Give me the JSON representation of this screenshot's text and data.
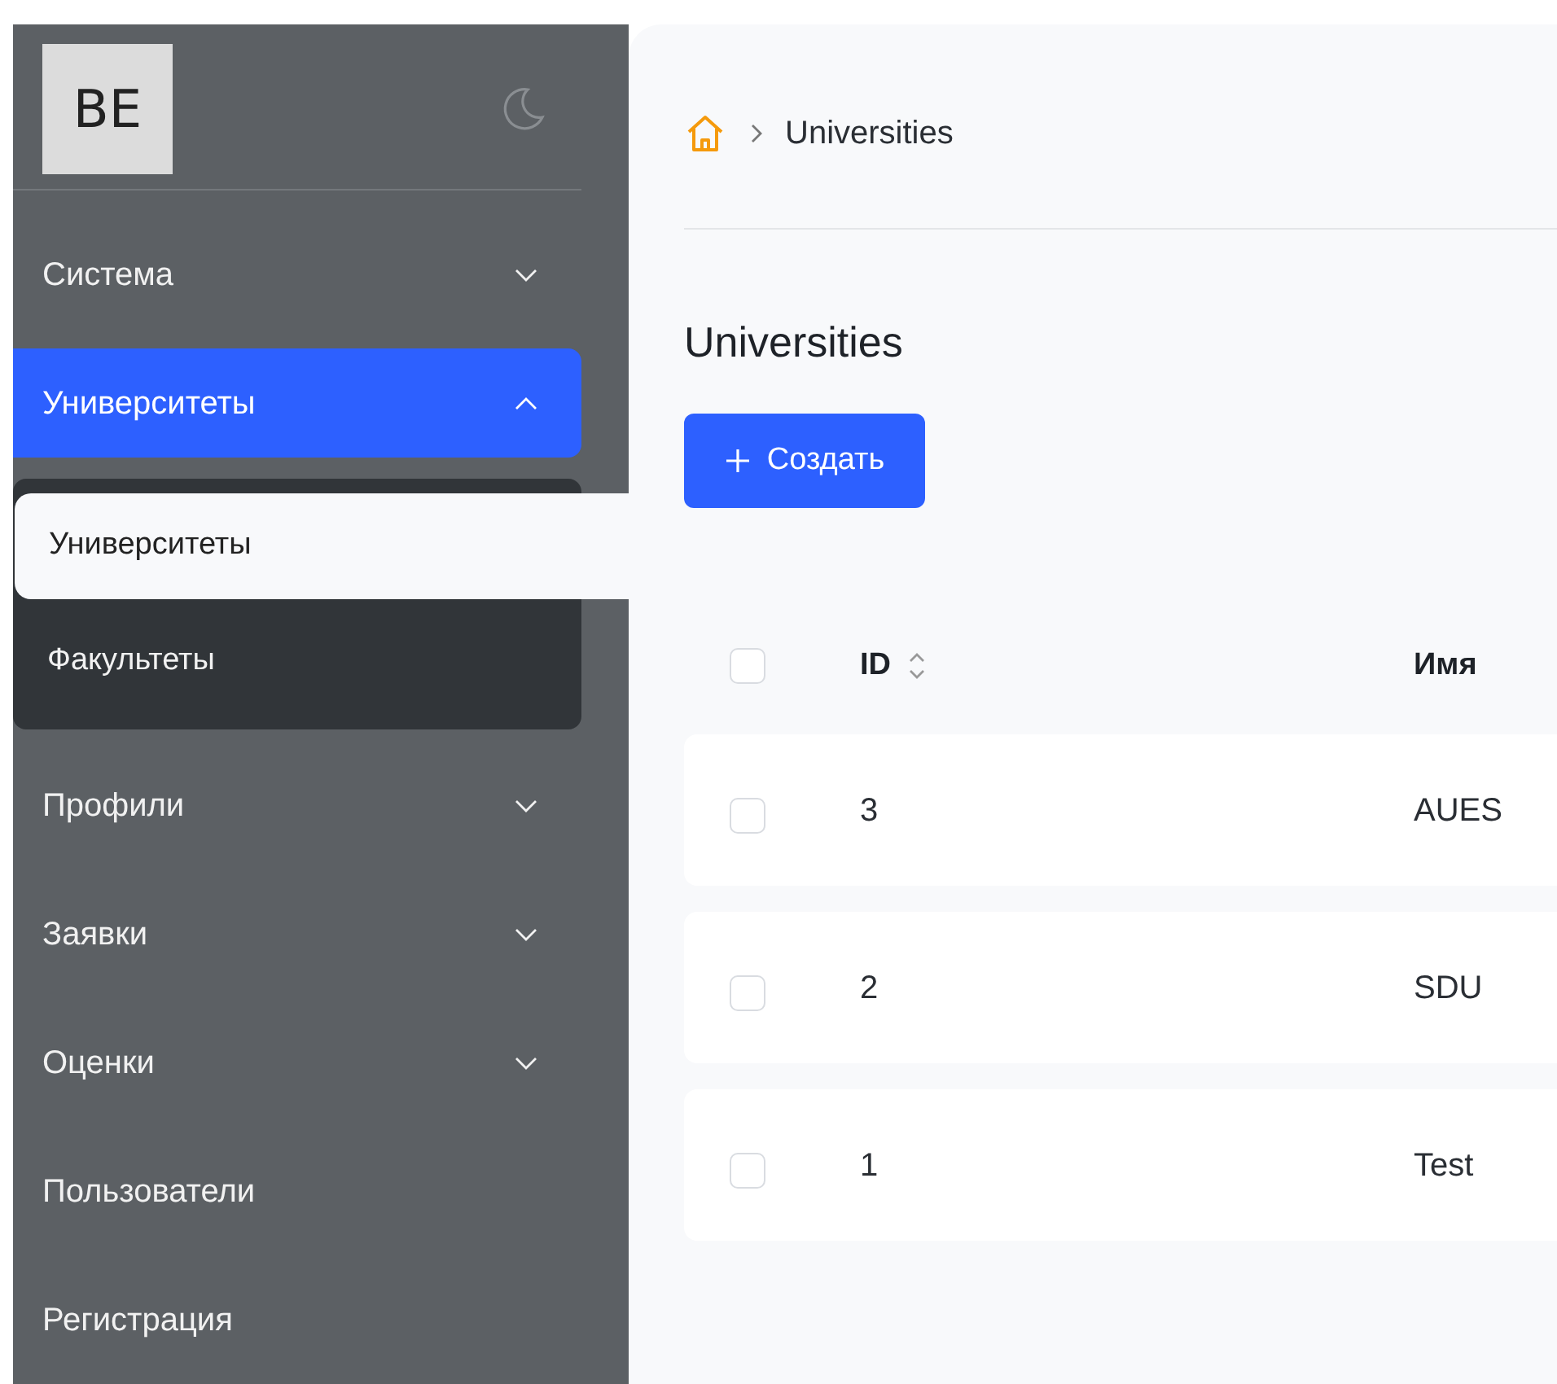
{
  "sidebar": {
    "logo": "BE",
    "items": [
      {
        "label": "Система",
        "kind": "group",
        "expanded": false,
        "selected": false
      },
      {
        "label": "Университеты",
        "kind": "group",
        "expanded": true,
        "selected": true,
        "children": [
          {
            "label": "Университеты",
            "selected": true
          },
          {
            "label": "Факультеты",
            "selected": false
          }
        ]
      },
      {
        "label": "Профили",
        "kind": "group",
        "expanded": false,
        "selected": false
      },
      {
        "label": "Заявки",
        "kind": "group",
        "expanded": false,
        "selected": false
      },
      {
        "label": "Оценки",
        "kind": "group",
        "expanded": false,
        "selected": false
      },
      {
        "label": "Пользователи",
        "kind": "link",
        "selected": false
      },
      {
        "label": "Регистрация",
        "kind": "link",
        "selected": false
      }
    ]
  },
  "breadcrumb": [
    "Universities"
  ],
  "title": "Universities",
  "create_button": "Создать",
  "table": {
    "select_all": {
      "checked": false
    },
    "columns": [
      "ID",
      "Имя"
    ],
    "rows": [
      {
        "checked": false,
        "cells": [
          "3",
          "AUES"
        ]
      },
      {
        "checked": false,
        "cells": [
          "2",
          "SDU"
        ]
      },
      {
        "checked": false,
        "cells": [
          "1",
          "Test"
        ]
      }
    ]
  }
}
